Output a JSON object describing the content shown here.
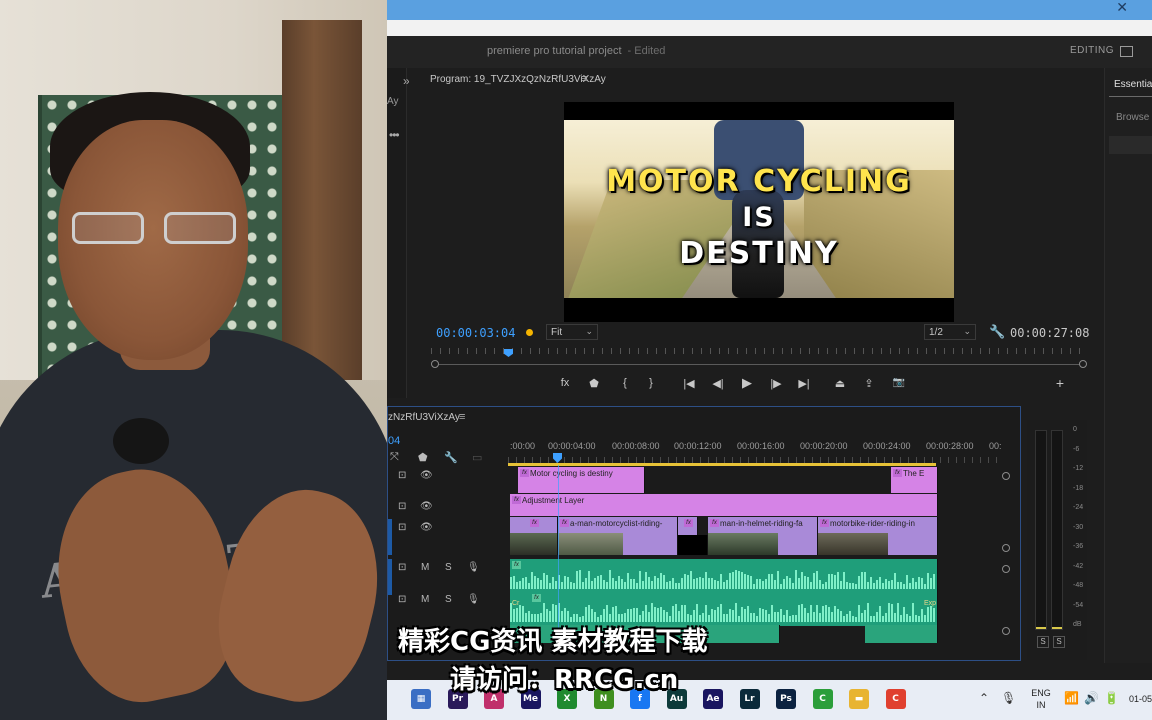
{
  "app": {
    "project_title": "premiere pro tutorial project",
    "edited_label": "- Edited",
    "workspace_label": "EDITING",
    "close_glyph": "✕"
  },
  "left_panel": {
    "chevron": "»",
    "label": "Ay",
    "dots": "•••"
  },
  "program_monitor": {
    "title": "Program: 19_TVZJXzQzNzRfU3ViXzAy",
    "menu_glyph": "≡",
    "current_timecode": "00:00:03:04",
    "fit_label": "Fit",
    "resolution_label": "1/2",
    "duration_timecode": "00:00:27:08",
    "video_text": [
      "MOTOR CYCLING",
      "IS",
      "DESTINY"
    ],
    "transport": [
      {
        "name": "fx-button",
        "glyph": "fx"
      },
      {
        "name": "add-marker-button",
        "glyph": "⬟"
      },
      {
        "name": "mark-in-button",
        "glyph": "{"
      },
      {
        "name": "mark-out-button",
        "glyph": "}"
      },
      {
        "name": "go-to-in-button",
        "glyph": "|◀"
      },
      {
        "name": "step-back-button",
        "glyph": "◀|"
      },
      {
        "name": "play-button",
        "glyph": "▶"
      },
      {
        "name": "step-forward-button",
        "glyph": "|▶"
      },
      {
        "name": "go-to-out-button",
        "glyph": "▶|"
      },
      {
        "name": "lift-button",
        "glyph": "⏏"
      },
      {
        "name": "extract-button",
        "glyph": "⇪"
      },
      {
        "name": "export-frame-button",
        "glyph": "📷"
      },
      {
        "name": "add-button",
        "glyph": "+"
      }
    ]
  },
  "essential_graphics": {
    "tab_label": "Essential",
    "browse_label": "Browse"
  },
  "timeline": {
    "sequence_title": "zNzRfU3ViXzAy",
    "menu_glyph": "≡",
    "timecode_fragment": "04",
    "ruler_labels": [
      ":00:00",
      "00:00:04:00",
      "00:00:08:00",
      "00:00:12:00",
      "00:00:16:00",
      "00:00:20:00",
      "00:00:24:00",
      "00:00:28:00",
      "00:"
    ],
    "video_tracks": [
      {
        "clips": [
          {
            "label": "Motor cycling is destiny",
            "color": "pink"
          },
          {
            "label": "The E",
            "color": "pink"
          }
        ]
      },
      {
        "clips": [
          {
            "label": "Adjustment Layer",
            "color": "pink"
          }
        ]
      },
      {
        "clips": [
          {
            "label": "a-man-motorcyclist-riding-",
            "color": "violet"
          },
          {
            "label": "man-in-helmet-riding-fa",
            "color": "violet"
          },
          {
            "label": "motorbike-rider-riding-in",
            "color": "violet"
          }
        ]
      }
    ],
    "track_buttons": {
      "mute": "M",
      "solo": "S"
    },
    "audio_clip_tags": [
      "Cr",
      "Exp"
    ]
  },
  "meters": {
    "scale": [
      "0",
      "-6",
      "-12",
      "-18",
      "-24",
      "-30",
      "-36",
      "-42",
      "-48",
      "-54",
      "dB"
    ],
    "solo_labels": [
      "S",
      "S"
    ]
  },
  "subtitles": {
    "line1": "精彩CG资讯 素材教程下载",
    "line2": "请访问：RRCG.cn"
  },
  "taskbar": {
    "apps": [
      {
        "name": "calculator-icon",
        "glyph": "▦",
        "color": "#3a6ec4"
      },
      {
        "name": "premiere-pro-icon",
        "glyph": "Pr",
        "color": "#2a1a5a"
      },
      {
        "name": "affinity-icon",
        "glyph": "A",
        "color": "#c0306b"
      },
      {
        "name": "media-encoder-icon",
        "glyph": "Me",
        "color": "#1a1660"
      },
      {
        "name": "xbox-icon",
        "glyph": "X",
        "color": "#1f8a2f"
      },
      {
        "name": "nvidia-icon",
        "glyph": "N",
        "color": "#3f8f1f"
      },
      {
        "name": "facebook-icon",
        "glyph": "f",
        "color": "#1877f2"
      },
      {
        "name": "audition-icon",
        "glyph": "Au",
        "color": "#0d3a3a"
      },
      {
        "name": "after-effects-icon",
        "glyph": "Ae",
        "color": "#1a1660"
      },
      {
        "name": "lightroom-icon",
        "glyph": "Lr",
        "color": "#0b2a3a"
      },
      {
        "name": "photoshop-icon",
        "glyph": "Ps",
        "color": "#0b2240"
      },
      {
        "name": "camtasia-icon",
        "glyph": "C",
        "color": "#2c9e3a"
      },
      {
        "name": "file-explorer-icon",
        "glyph": "▬",
        "color": "#e8b432"
      },
      {
        "name": "camtasia-recorder-icon",
        "glyph": "C",
        "color": "#e0402f"
      }
    ],
    "lang_line1": "ENG",
    "lang_line2": "IN",
    "clock_fragment": "01-05"
  }
}
